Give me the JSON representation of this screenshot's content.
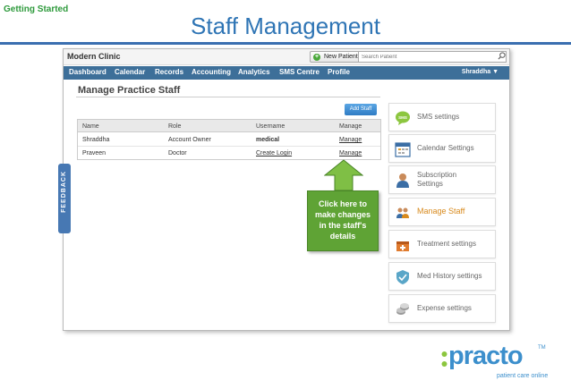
{
  "slide": {
    "section": "Getting Started",
    "title": "Staff Management"
  },
  "app": {
    "clinic_name": "Modern Clinic",
    "new_patient_label": "New Patient",
    "search_placeholder": "Search Patient",
    "nav_items": [
      "Dashboard",
      "Calendar",
      "Records",
      "Accounting",
      "Analytics",
      "SMS Centre",
      "Profile"
    ],
    "user_menu_label": "Shraddha ▼",
    "feedback_label": "FEEDBACK"
  },
  "main": {
    "heading": "Manage Practice Staff",
    "add_staff_label": "Add Staff",
    "table": {
      "columns": [
        "Name",
        "Role",
        "Username",
        "Manage"
      ],
      "rows": [
        {
          "name": "Shraddha",
          "role": "Account Owner",
          "username": "medical",
          "manage": "Manage"
        },
        {
          "name": "Praveen",
          "role": "Doctor",
          "username": "Create Login",
          "manage": "Manage"
        }
      ]
    }
  },
  "callout": {
    "text_lines": [
      "Click here to",
      "make changes",
      "in the staff's",
      "details"
    ],
    "color": "#5fa335"
  },
  "settings": [
    {
      "label": "SMS settings",
      "icon": "sms-bubble-icon"
    },
    {
      "label": "Calendar Settings",
      "icon": "calendar-icon"
    },
    {
      "label_lines": [
        "Subscription",
        "Settings"
      ],
      "icon": "person-icon"
    },
    {
      "label": "Manage Staff",
      "icon": "staff-group-icon",
      "active": true
    },
    {
      "label": "Treatment settings",
      "icon": "treatment-box-icon"
    },
    {
      "label": "Med History settings",
      "icon": "shield-icon"
    },
    {
      "label": "Expense settings",
      "icon": "coins-icon"
    }
  ],
  "brand": {
    "logo_text": "practo",
    "tagline": "patient care online",
    "trademark": "TM",
    "color": "#3c8fcc"
  }
}
